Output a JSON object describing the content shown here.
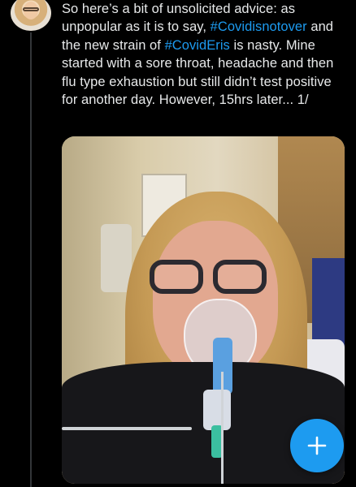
{
  "tweet": {
    "segments": [
      {
        "text": "So here’s a bit of unsolicited advice: as unpopular as it is to say, ",
        "type": "text"
      },
      {
        "text": "#Covidisnotover",
        "type": "hashtag"
      },
      {
        "text": " and the new strain of ",
        "type": "text"
      },
      {
        "text": "#CovidEris",
        "type": "hashtag"
      },
      {
        "text": " is nasty. Mine started with a sore throat, headache and then flu type exhaustion but still didn’t test positive for another day. However, 15hrs later... 1/",
        "type": "text"
      }
    ]
  },
  "colors": {
    "background": "#000000",
    "text": "#e7e9ea",
    "accent": "#1d9bf0"
  },
  "fab": {
    "icon": "plus-icon"
  },
  "avatar": {
    "icon": "avatar"
  }
}
